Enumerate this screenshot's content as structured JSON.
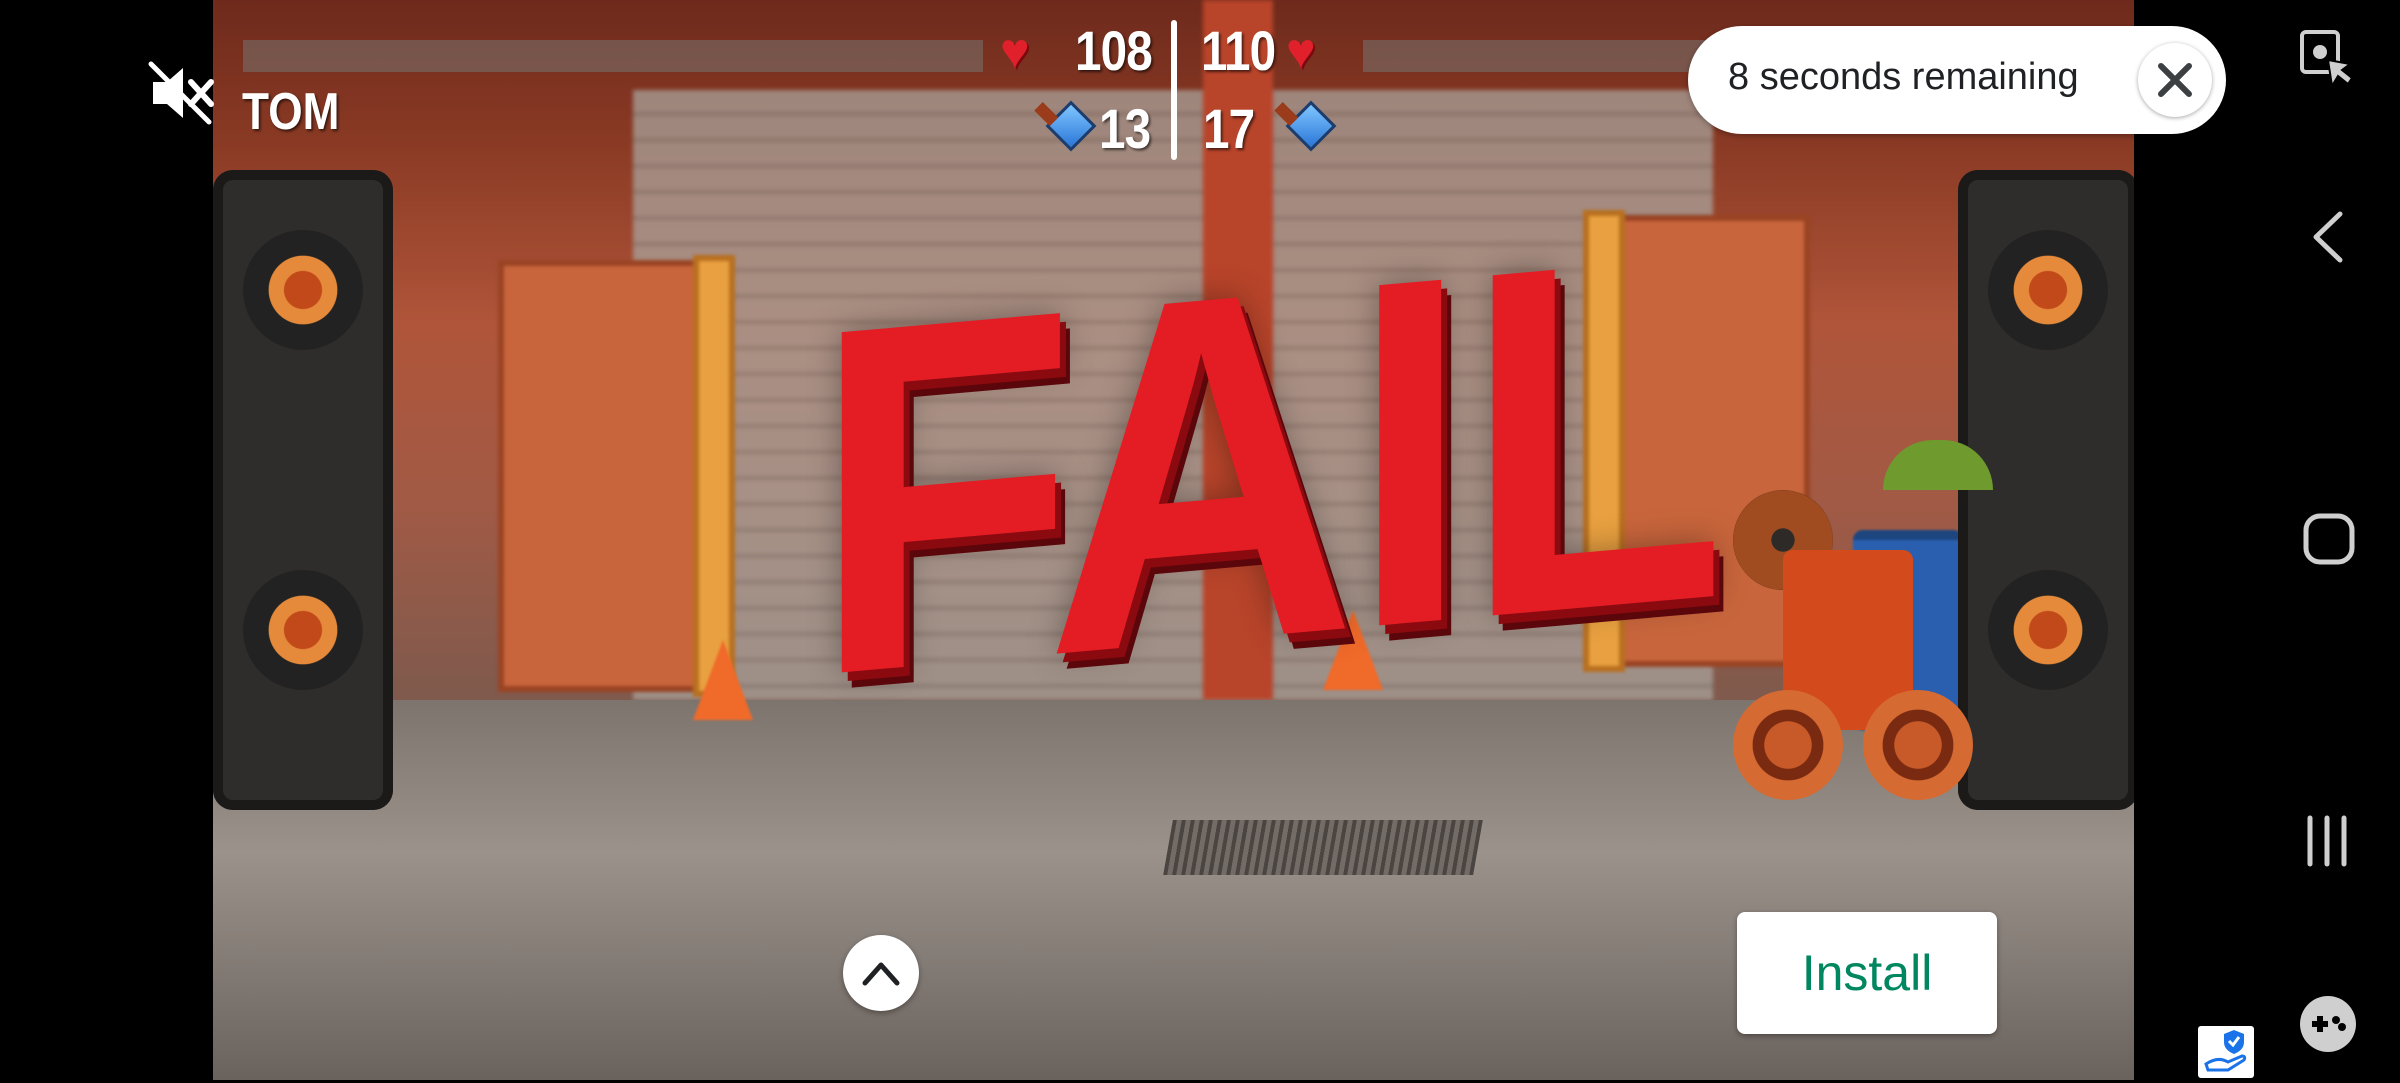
{
  "hud": {
    "player_name": "TOM",
    "left_health": "108",
    "right_health": "110",
    "left_power": "13",
    "right_power": "17"
  },
  "game": {
    "banner_text": "FAIL"
  },
  "ad": {
    "timer_text": "8 seconds remaining",
    "install_label": "Install"
  },
  "icons": {
    "mute": "volume-off-icon",
    "close": "close-icon",
    "expand": "chevron-up-icon",
    "screenshot_touch": "screenshot-touch-icon",
    "back": "back-icon",
    "home": "home-icon",
    "recents": "recents-icon",
    "game_launcher": "game-controller-icon",
    "ad_privacy": "ad-choices-icon"
  },
  "colors": {
    "install_text": "#01875f",
    "fail_red": "#e41c24",
    "heart_red": "#e0202a"
  }
}
